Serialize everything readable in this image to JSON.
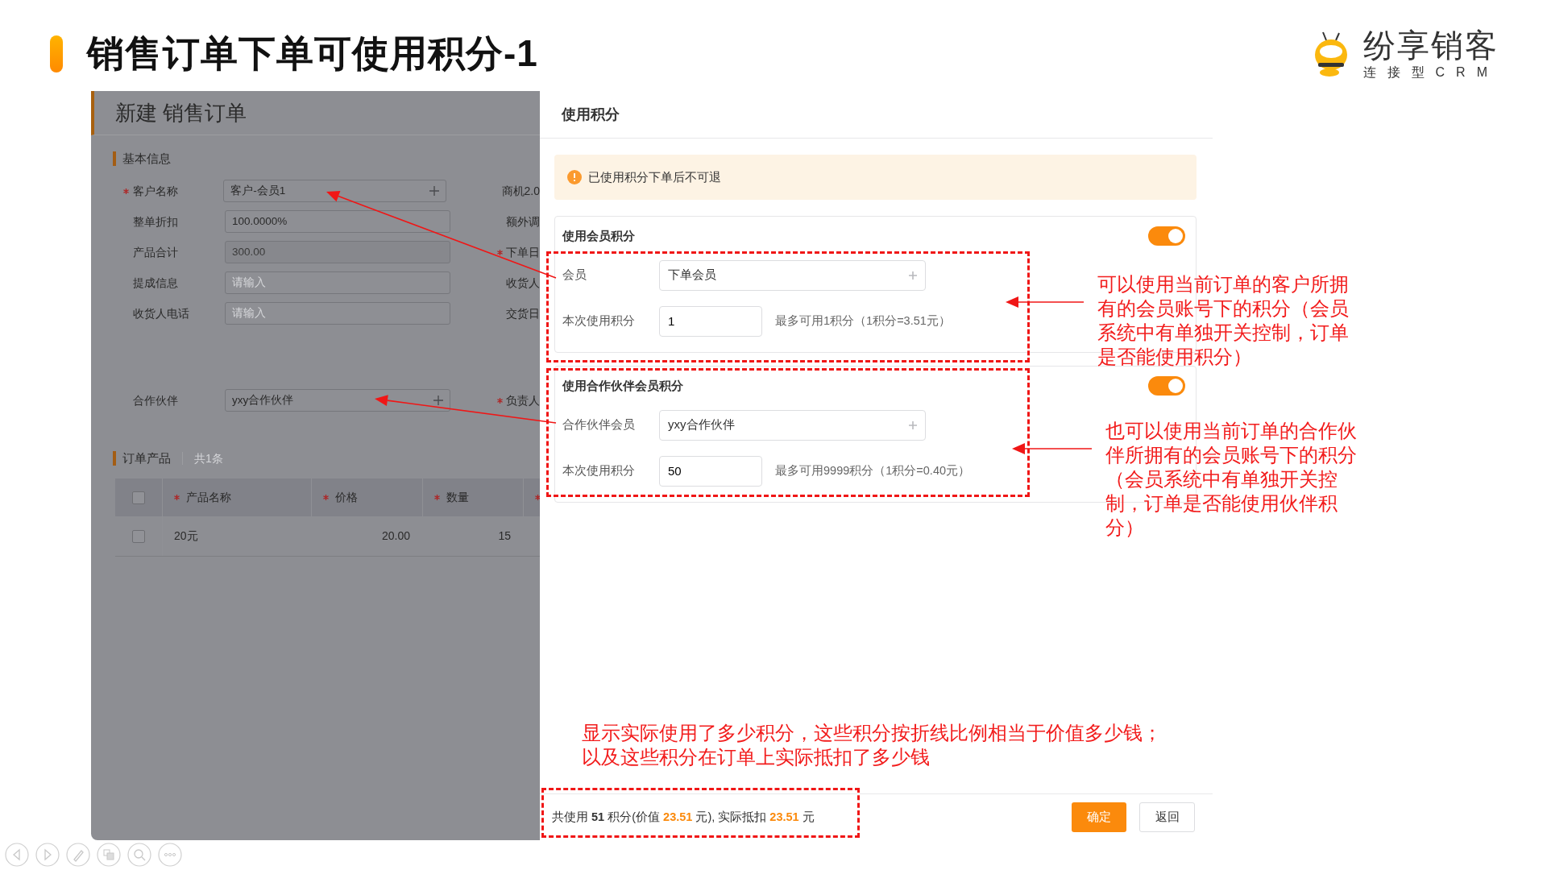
{
  "slide": {
    "title": "销售订单下单可使用积分-1"
  },
  "logo": {
    "name": "纷享销客",
    "tagline": "连接型CRM"
  },
  "order_form": {
    "title": "新建 销售订单",
    "basic_section": "基本信息",
    "fields": [
      {
        "label": "客户名称",
        "required": true,
        "kind": "select",
        "value": "客户-会员1",
        "side_label": "商机2.0",
        "side_required": false
      },
      {
        "label": "整单折扣",
        "required": false,
        "kind": "input",
        "value": "100.0000%",
        "side_label": "额外调",
        "side_required": false
      },
      {
        "label": "产品合计",
        "required": false,
        "kind": "readonly",
        "value": "300.00",
        "side_label": "下单日",
        "side_required": true
      },
      {
        "label": "提成信息",
        "required": false,
        "kind": "input",
        "placeholder": "请输入",
        "side_label": "收货人",
        "side_required": false
      },
      {
        "label": "收货人电话",
        "required": false,
        "kind": "input",
        "placeholder": "请输入",
        "side_label": "交货日",
        "side_required": false
      }
    ],
    "partner_field": {
      "label": "合作伙伴",
      "required": false,
      "kind": "select",
      "value": "yxy合作伙伴",
      "side_label": "负责人",
      "side_required": true
    },
    "products_section": {
      "title": "订单产品",
      "count": "共1条"
    },
    "table": {
      "select_all": {
        "checked": false
      },
      "columns": [
        {
          "label": "产品名称",
          "required": true
        },
        {
          "label": "价格",
          "required": true
        },
        {
          "label": "数量",
          "required": true
        },
        {
          "required": true
        }
      ],
      "rows": [
        {
          "checked": false,
          "cells": [
            "20元",
            "20.00",
            "15"
          ]
        }
      ]
    }
  },
  "dialog": {
    "title": "使用积分",
    "notice": "已使用积分下单后不可退",
    "sections": [
      {
        "title": "使用会员积分",
        "on": true,
        "member": {
          "label": "会员",
          "value": "下单会员"
        },
        "points": {
          "label": "本次使用积分",
          "value": "1",
          "hint": "最多可用1积分（1积分=3.51元）"
        }
      },
      {
        "title": "使用合作伙伴会员积分",
        "on": true,
        "member": {
          "label": "合作伙伴会员",
          "value": "yxy合作伙伴"
        },
        "points": {
          "label": "本次使用积分",
          "value": "50",
          "hint": "最多可用9999积分（1积分=0.40元）"
        }
      }
    ],
    "summary": [
      {
        "text": "共使用 ",
        "kind": "plain"
      },
      {
        "text": "51",
        "kind": "bold"
      },
      {
        "text": " 积分(价值 ",
        "kind": "plain"
      },
      {
        "text": "23.51",
        "kind": "accent"
      },
      {
        "text": " 元), 实际抵扣 ",
        "kind": "plain"
      },
      {
        "text": "23.51",
        "kind": "accent"
      },
      {
        "text": " 元",
        "kind": "plain"
      }
    ],
    "buttons": [
      {
        "label": "确定",
        "kind": "primary"
      },
      {
        "label": "返回",
        "kind": "default"
      }
    ]
  },
  "annotations": [
    {
      "text": "可以使用当前订单的客户所拥有的会员账号下的积分（会员系统中有单独开关控制，订单是否能使用积分）"
    },
    {
      "text": "也可以使用当前订单的合作伙伴所拥有的会员账号下的积分（会员系统中有单独开关控制，订单是否能使用伙伴积分）"
    },
    {
      "text": "显示实际使用了多少积分，这些积分按折线比例相当于价值多少钱；以及这些积分在订单上实际抵扣了多少钱"
    }
  ]
}
